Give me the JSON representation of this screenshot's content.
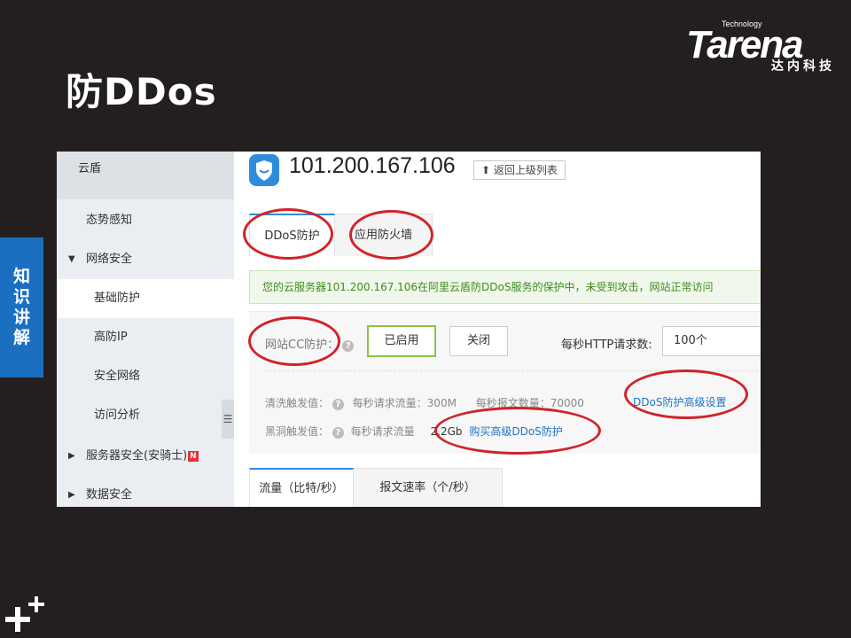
{
  "slide": {
    "title": "防DDos",
    "logo_tagline": "Technology",
    "logo_word": "Tarena",
    "logo_cn": "达内科技",
    "side_tab": [
      "知",
      "识",
      "讲",
      "解"
    ]
  },
  "sidebar": {
    "header": "云盾",
    "items": [
      {
        "label": "态势感知"
      },
      {
        "label": "网络安全",
        "caret": "▼"
      },
      {
        "label": "基础防护"
      },
      {
        "label": "高防IP"
      },
      {
        "label": "安全网络"
      },
      {
        "label": "访问分析"
      },
      {
        "label": "服务器安全(安骑士)",
        "caret": "▶",
        "badge": "N"
      },
      {
        "label": "数据安全",
        "caret": "▶"
      }
    ],
    "collapse_icon": "☰"
  },
  "main": {
    "ip": "101.200.167.106",
    "back_button": "返回上级列表",
    "tabs": [
      "DDoS防护",
      "应用防火墙"
    ],
    "notice": "您的云服务器101.200.167.106在阿里云盾防DDoS服务的保护中，未受到攻击，网站正常访问",
    "cc": {
      "label": "网站CC防护：",
      "enabled_button": "已启用",
      "close_button": "关闭",
      "http_label": "每秒HTTP请求数:",
      "http_value": "100个"
    },
    "clean": {
      "label": "清洗触发值：",
      "flow": "每秒请求流量：300M",
      "packets": "每秒报文数量：70000",
      "advanced_link": "DDoS防护高级设置"
    },
    "blackhole": {
      "label": "黑洞触发值：",
      "flow_label": "每秒请求流量",
      "flow_value": "2.2Gb",
      "buy_link": "购买高级DDoS防护"
    },
    "bottom_tabs": [
      "流量（比特/秒）",
      "报文速率（个/秒）"
    ]
  },
  "colors": {
    "accent": "#2f8cdb",
    "highlight": "#d0232a",
    "success": "#3f8a1e",
    "slide_bg": "#231f20",
    "side_tab": "#1b6fc0"
  }
}
